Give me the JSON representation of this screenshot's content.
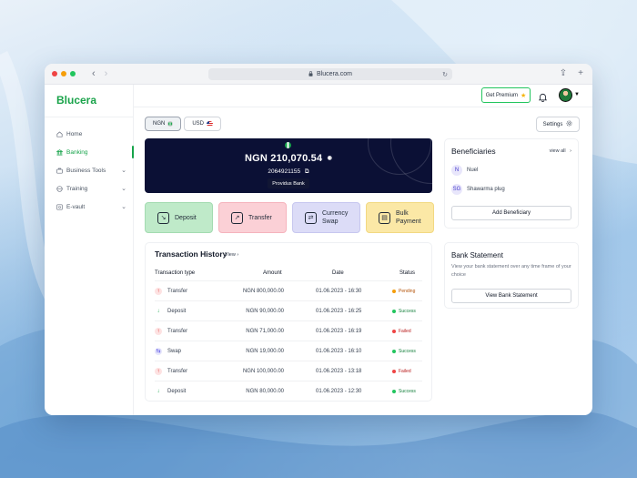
{
  "browser": {
    "url": "Blucera.com"
  },
  "brand": {
    "name": "Blucera",
    "color": "#1aa34a"
  },
  "sidebar": {
    "items": [
      {
        "label": "Home",
        "icon": "home-icon",
        "active": false
      },
      {
        "label": "Banking",
        "icon": "bank-icon",
        "active": true
      },
      {
        "label": "Business Tools",
        "icon": "briefcase-icon",
        "expandable": true
      },
      {
        "label": "Training",
        "icon": "training-icon",
        "expandable": true
      },
      {
        "label": "E-vault",
        "icon": "vault-icon",
        "expandable": true
      }
    ]
  },
  "header": {
    "premium_label": "Get Premium",
    "premium_icon": "star-icon"
  },
  "currency_tabs": [
    {
      "label": "NGN",
      "flag": "nigeria-flag",
      "active": true
    },
    {
      "label": "USD",
      "flag": "us-flag",
      "active": false
    }
  ],
  "settings_label": "Settings",
  "balance": {
    "currency": "NGN",
    "amount": "210,070.54",
    "account_number": "2064921155",
    "bank": "Providus Bank",
    "card_color": "#0b1035"
  },
  "actions": [
    {
      "label": "Deposit",
      "icon": "deposit-icon",
      "color": "#bfeac9"
    },
    {
      "label": "Transfer",
      "icon": "transfer-icon",
      "color": "#fbd0d6"
    },
    {
      "label": "Currency Swap",
      "line1": "Currency",
      "line2": "Swap",
      "icon": "swap-icon",
      "color": "#dcdcf7"
    },
    {
      "label": "Bulk Payment",
      "line1": "Bulk",
      "line2": "Payment",
      "icon": "bulk-payment-icon",
      "color": "#fbe8a6"
    }
  ],
  "transactions": {
    "title": "Transaction History",
    "view_label": "View",
    "columns": [
      "Transaction type",
      "Amount",
      "Date",
      "Status"
    ],
    "rows": [
      {
        "type": "Transfer",
        "dir": "out",
        "amount": "NGN 800,000.00",
        "date": "01.06.2023 - 16:30",
        "status": "Pending"
      },
      {
        "type": "Deposit",
        "dir": "in",
        "amount": "NGN 90,000.00",
        "date": "01.06.2023 - 16:25",
        "status": "Success"
      },
      {
        "type": "Transfer",
        "dir": "out",
        "amount": "NGN 71,000.00",
        "date": "01.06.2023 - 16:19",
        "status": "Failed"
      },
      {
        "type": "Swap",
        "dir": "swap",
        "amount": "NGN 19,000.00",
        "date": "01.06.2023 - 16:10",
        "status": "Success"
      },
      {
        "type": "Transfer",
        "dir": "out",
        "amount": "NGN 100,000.00",
        "date": "01.06.2023 - 13:18",
        "status": "Failed"
      },
      {
        "type": "Deposit",
        "dir": "in",
        "amount": "NGN 80,000.00",
        "date": "01.06.2023 - 12:30",
        "status": "Success"
      }
    ]
  },
  "beneficiaries": {
    "title": "Beneficiaries",
    "view_all": "view all",
    "items": [
      {
        "initials": "N",
        "name": "Nuel"
      },
      {
        "initials": "SG",
        "name": "Shawarma plug"
      }
    ],
    "add_label": "Add Beneficiary"
  },
  "statement": {
    "title": "Bank Statement",
    "description": "View your bank statement over any time frame of your choice",
    "button_label": "View Bank Statement"
  },
  "status_colors": {
    "Pending": "#f59e0b",
    "Success": "#22c55e",
    "Failed": "#ef4444"
  }
}
